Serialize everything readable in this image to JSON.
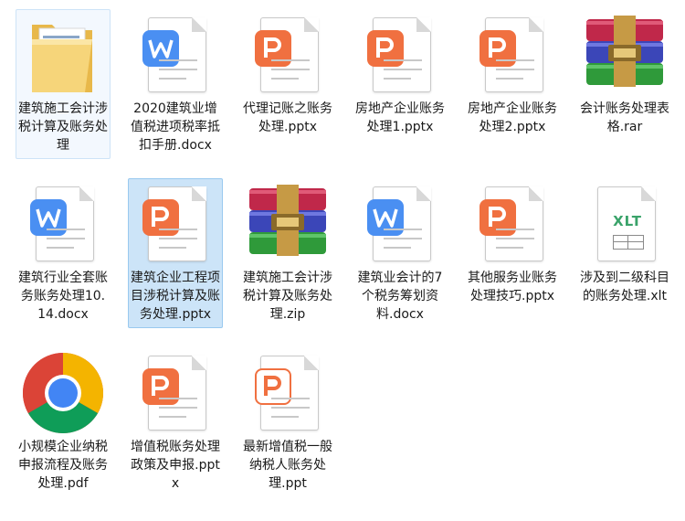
{
  "files": [
    {
      "label": "建筑施工会计涉税计算及账务处理",
      "icon": "folder-icon"
    },
    {
      "label": "2020建筑业增值税进项税率抵扣手册.docx",
      "icon": "word-document-icon"
    },
    {
      "label": "代理记账之账务处理.pptx",
      "icon": "powerpoint-icon"
    },
    {
      "label": "房地产企业账务处理1.pptx",
      "icon": "powerpoint-icon"
    },
    {
      "label": "房地产企业账务处理2.pptx",
      "icon": "powerpoint-icon"
    },
    {
      "label": "会计账务处理表格.rar",
      "icon": "winrar-archive-icon"
    },
    {
      "label": "建筑行业全套账务账务处理10.14.docx",
      "icon": "word-document-icon"
    },
    {
      "label": "建筑企业工程项目涉税计算及账务处理.pptx",
      "icon": "powerpoint-icon"
    },
    {
      "label": "建筑施工会计涉税计算及账务处理.zip",
      "icon": "winrar-archive-icon"
    },
    {
      "label": "建筑业会计的7个税务筹划资料.docx",
      "icon": "word-document-icon"
    },
    {
      "label": "其他服务业账务处理技巧.pptx",
      "icon": "powerpoint-icon"
    },
    {
      "label": "涉及到二级科目的账务处理.xlt",
      "icon": "excel-template-icon",
      "icon_text": "XLT"
    },
    {
      "label": "小规模企业纳税申报流程及账务处理.pdf",
      "icon": "chrome-pdf-icon"
    },
    {
      "label": "增值税账务处理政策及申报.pptx",
      "icon": "powerpoint-icon"
    },
    {
      "label": "最新增值税一般纳税人账务处理.ppt",
      "icon": "powerpoint-legacy-icon"
    }
  ],
  "colors": {
    "selection": "#cce4f8",
    "selection_border": "#99c9ef",
    "word": "#4a8ff2",
    "powerpoint": "#f07040",
    "xlt": "#3aa36a"
  }
}
